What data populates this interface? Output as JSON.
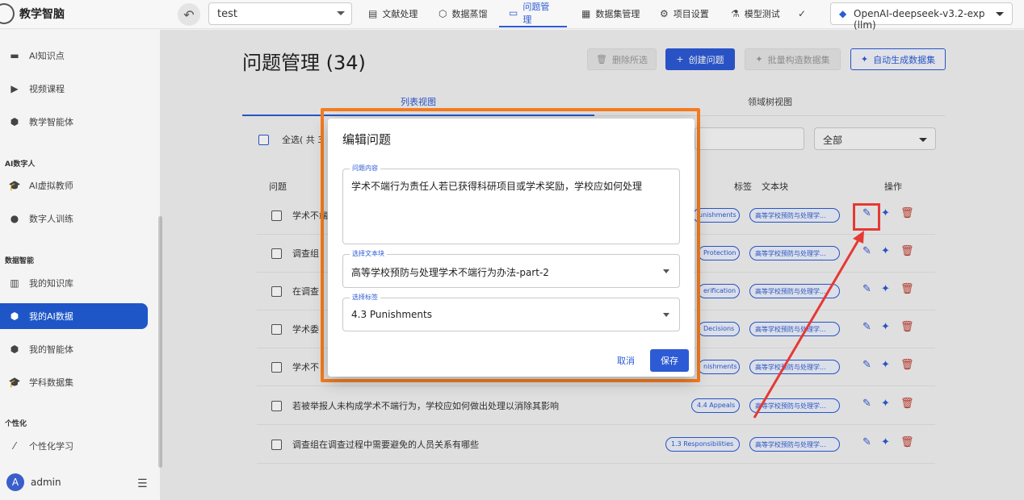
{
  "app": {
    "title": "教学智脑"
  },
  "topbar": {
    "project": "test",
    "nav": [
      {
        "label": "文献处理",
        "icon": "document-icon"
      },
      {
        "label": "数据蒸馏",
        "icon": "cube-icon"
      },
      {
        "label": "问题管理",
        "icon": "chat-icon",
        "active": true
      },
      {
        "label": "数据集管理",
        "icon": "grid-icon"
      },
      {
        "label": "项目设置",
        "icon": "gear-icon"
      },
      {
        "label": "模型测试",
        "icon": "flask-icon"
      }
    ],
    "model": "OpenAI-deepseek-v3.2-exp (llm)"
  },
  "sidebar": {
    "items_top": [
      {
        "label": "AI知识点",
        "icon": "film-icon"
      },
      {
        "label": "视频课程",
        "icon": "video-icon"
      },
      {
        "label": "教学智能体",
        "icon": "cube-icon"
      }
    ],
    "group_digital_human": "AI数字人",
    "items_dh": [
      {
        "label": "AI虚拟教师",
        "icon": "graduation-cap-icon"
      },
      {
        "label": "数字人训练",
        "icon": "person-icon"
      }
    ],
    "group_data": "数据智能",
    "items_data": [
      {
        "label": "我的知识库",
        "icon": "book-icon"
      },
      {
        "label": "我的AI数据",
        "icon": "box-icon",
        "active": true
      },
      {
        "label": "我的智能体",
        "icon": "cube-icon"
      },
      {
        "label": "学科数据集",
        "icon": "graduation-cap-icon"
      }
    ],
    "group_personal": "个性化",
    "items_personal": [
      {
        "label": "个性化学习",
        "icon": "wand-icon"
      }
    ],
    "user": "admin",
    "user_initial": "A"
  },
  "main": {
    "title": "问题管理 (34)",
    "buttons": {
      "delete_selected": "删除所选",
      "create_question": "创建问题",
      "batch_build": "批量构造数据集",
      "auto_generate": "自动生成数据集"
    },
    "tabs": {
      "list": "列表视图",
      "tree": "领域树视图"
    },
    "select_all": "全选( 共 3",
    "filter": "全部",
    "columns": {
      "question": "问题",
      "tag": "标签",
      "chunk": "文本块",
      "actions": "操作"
    },
    "rows": [
      {
        "text": "学术不端",
        "tag": "unishments",
        "chunk": "高等学校预防与处理学..."
      },
      {
        "text": "调查组",
        "tag": "Protection",
        "chunk": "高等学校预防与处理学..."
      },
      {
        "text": "在调查",
        "tag": "erification",
        "chunk": "高等学校预防与处理学..."
      },
      {
        "text": "学术委",
        "tag": "Decisions",
        "chunk": "高等学校预防与处理学..."
      },
      {
        "text": "学术不",
        "tag": "nishments",
        "chunk": "高等学校预防与处理学..."
      },
      {
        "text": "若被举报人未构成学术不端行为，学校应如何做出处理以消除其影响",
        "tag": "4.4 Appeals",
        "chunk": "高等学校预防与处理学..."
      },
      {
        "text": "调查组在调查过程中需要避免的人员关系有哪些",
        "tag": "1.3 Responsibilities",
        "chunk": "高等学校预防与处理学..."
      }
    ]
  },
  "dialog": {
    "title": "编辑问题",
    "content_label": "问题内容",
    "content_value": "学术不端行为责任人若已获得科研项目或学术奖励，学校应如何处理",
    "chunk_label": "选择文本块",
    "chunk_value": "高等学校预防与处理学术不端行为办法-part-2",
    "tag_label": "选择标签",
    "tag_value": "4.3 Punishments",
    "cancel": "取消",
    "save": "保存"
  },
  "colors": {
    "accent": "#2d5bd6",
    "annotation_orange": "#f57c1f",
    "annotation_red": "#e53935",
    "delete_red": "#c0392b"
  }
}
